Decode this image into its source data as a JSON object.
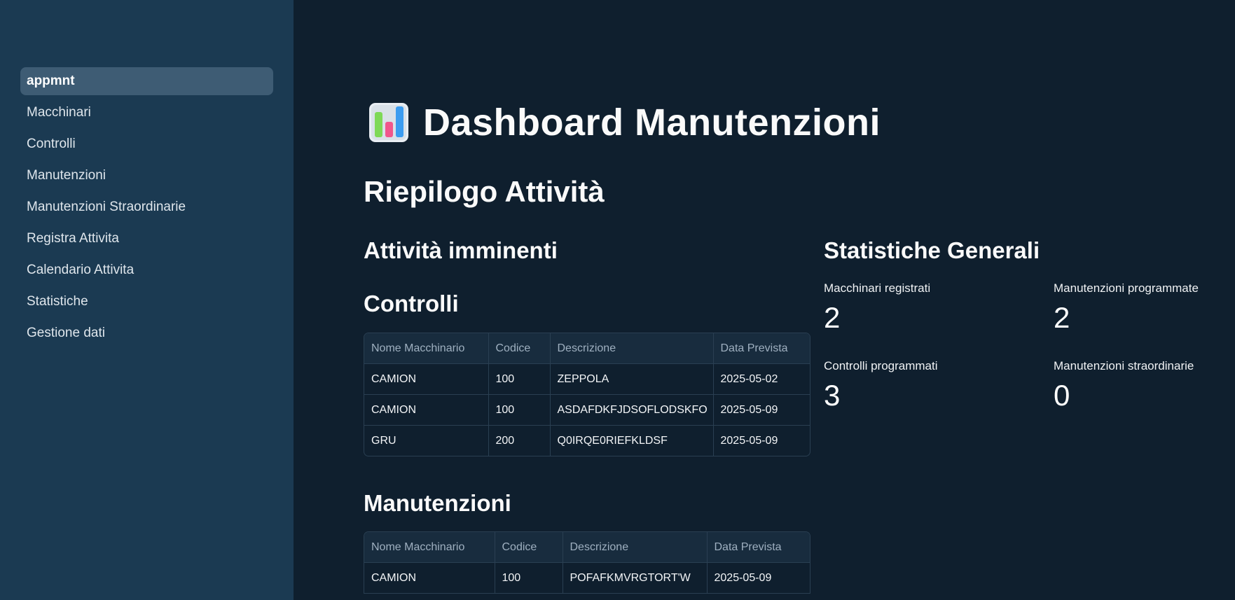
{
  "sidebar": {
    "items": [
      {
        "label": "appmnt"
      },
      {
        "label": "Macchinari"
      },
      {
        "label": "Controlli"
      },
      {
        "label": "Manutenzioni"
      },
      {
        "label": "Manutenzioni Straordinarie"
      },
      {
        "label": "Registra Attivita"
      },
      {
        "label": "Calendario Attivita"
      },
      {
        "label": "Statistiche"
      },
      {
        "label": "Gestione dati"
      }
    ],
    "active_index": 0,
    "bg_color": "#1b3a52",
    "active_bg_color": "#3e5c74"
  },
  "main": {
    "title_icon": "bar-chart-icon",
    "title": "Dashboard Manutenzioni",
    "summary_heading": "Riepilogo Attività",
    "upcoming_heading": "Attività imminenti",
    "controlli": {
      "heading": "Controlli",
      "columns": [
        "Nome Macchinario",
        "Codice",
        "Descrizione",
        "Data Prevista"
      ],
      "rows": [
        [
          "CAMION",
          "100",
          "ZEPPOLA",
          "2025-05-02"
        ],
        [
          "CAMION",
          "100",
          "ASDAFDKFJDSOFLODSKFO",
          "2025-05-09"
        ],
        [
          "GRU",
          "200",
          "Q0IRQE0RIEFKLDSF",
          "2025-05-09"
        ]
      ]
    },
    "manutenzioni": {
      "heading": "Manutenzioni",
      "columns": [
        "Nome Macchinario",
        "Codice",
        "Descrizione",
        "Data Prevista"
      ],
      "rows": [
        [
          "CAMION",
          "100",
          "POFAFKMVRGTORT'W",
          "2025-05-09"
        ]
      ]
    },
    "stats": {
      "heading": "Statistiche Generali",
      "metrics": [
        {
          "label": "Macchinari registrati",
          "value": "2"
        },
        {
          "label": "Manutenzioni programmate",
          "value": "2"
        },
        {
          "label": "Controlli programmati",
          "value": "3"
        },
        {
          "label": "Manutenzioni straordinarie",
          "value": "0"
        }
      ]
    }
  },
  "colors": {
    "background": "#0f1f2e",
    "table_header_bg": "#182c3e",
    "table_border": "#2a3f52"
  }
}
